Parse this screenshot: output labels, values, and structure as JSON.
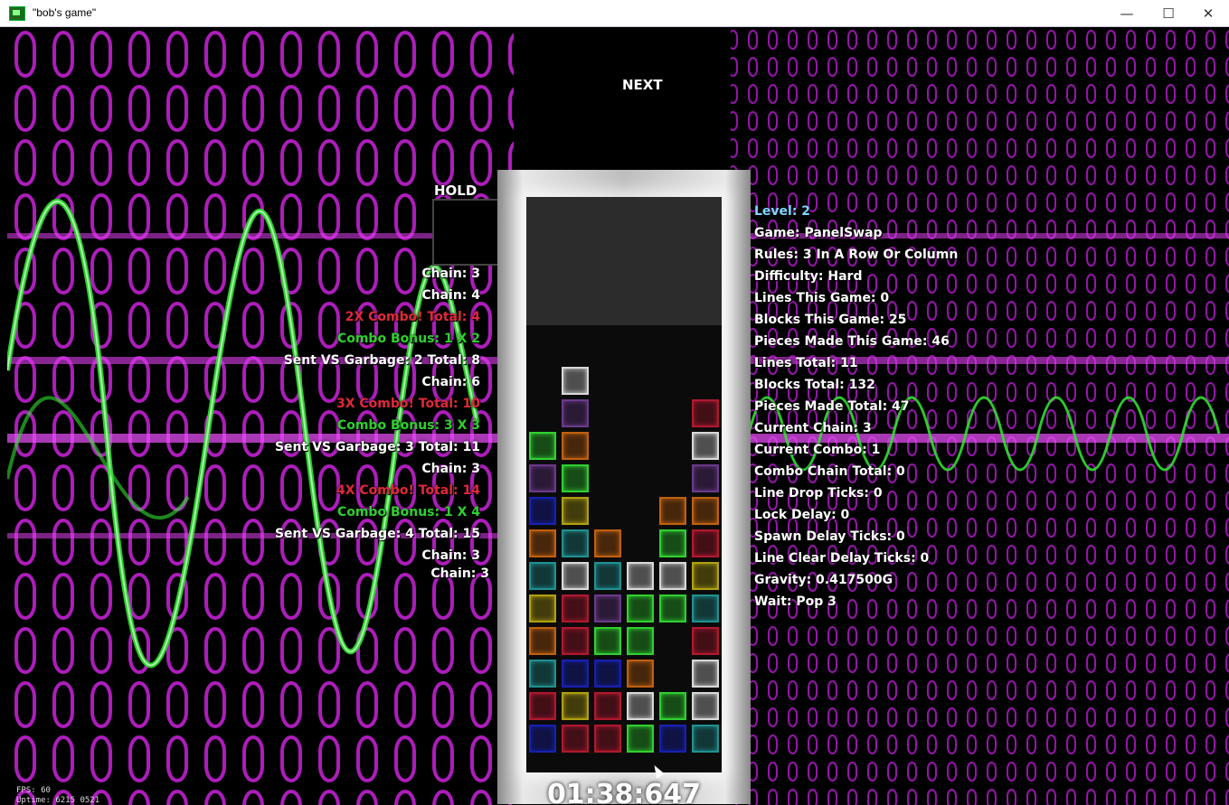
{
  "window": {
    "title": "\"bob's game\"",
    "minimize": "—",
    "maximize": "☐",
    "close": "✕"
  },
  "next_label": "NEXT",
  "hold_label": "HOLD",
  "left_stats": [
    {
      "text": "Chain: 3",
      "color": "white"
    },
    {
      "text": "Chain: 4",
      "color": "white"
    },
    {
      "text": "2X Combo! Total: 4",
      "color": "red"
    },
    {
      "text": "Combo Bonus: 1 X 2",
      "color": "green"
    },
    {
      "text": "Sent VS Garbage: 2 Total: 8",
      "color": "white"
    },
    {
      "text": "Chain: 6",
      "color": "white"
    },
    {
      "text": "3X Combo! Total: 10",
      "color": "red"
    },
    {
      "text": "Combo Bonus: 3 X 3",
      "color": "green"
    },
    {
      "text": "Sent VS Garbage: 3 Total: 11",
      "color": "white"
    },
    {
      "text": "Chain: 3",
      "color": "white"
    },
    {
      "text": "4X Combo! Total: 14",
      "color": "red"
    },
    {
      "text": "Combo Bonus: 1 X 4",
      "color": "green"
    },
    {
      "text": "Sent VS Garbage: 4 Total: 15",
      "color": "white"
    },
    {
      "text": "Chain: 3",
      "color": "white"
    },
    {
      "text": "Chain: 3",
      "color": "white"
    }
  ],
  "right_stats": [
    {
      "text": "Level: 2",
      "color": "blue"
    },
    {
      "text": "Game: PanelSwap",
      "color": "white"
    },
    {
      "text": "Rules: 3 In A Row Or Column",
      "color": "white"
    },
    {
      "text": "Difficulty: Hard",
      "color": "white"
    },
    {
      "text": "Lines This Game: 0",
      "color": "white"
    },
    {
      "text": "Blocks This Game: 25",
      "color": "white"
    },
    {
      "text": "Pieces Made This Game: 46",
      "color": "white"
    },
    {
      "text": "Lines Total: 11",
      "color": "white"
    },
    {
      "text": "Blocks Total: 132",
      "color": "white"
    },
    {
      "text": "Pieces Made Total: 47",
      "color": "white"
    },
    {
      "text": "Current Chain: 3",
      "color": "white"
    },
    {
      "text": "Current Combo: 1",
      "color": "white"
    },
    {
      "text": "Combo Chain Total: 0",
      "color": "white"
    },
    {
      "text": "Line Drop Ticks: 0",
      "color": "white"
    },
    {
      "text": "Lock Delay: 0",
      "color": "white"
    },
    {
      "text": "Spawn Delay Ticks: 0",
      "color": "white"
    },
    {
      "text": "Line Clear Delay Ticks: 0",
      "color": "white"
    },
    {
      "text": "Gravity: 0.417500G",
      "color": "white"
    },
    {
      "text": "Wait: Pop 3",
      "color": "white"
    }
  ],
  "timer": "01:38:647",
  "fps_line1": "FPS: 60",
  "fps_line2": "Uptime: 6215 0521",
  "colors": {
    "magenta": "#c020d0",
    "green": "#30d030",
    "gray": "#d8d8d8",
    "purple": "#6a3a8a",
    "red": "#b01830",
    "orange": "#c06010",
    "yellow": "#b0a010",
    "cyan": "#209090",
    "blue": "#1820b0"
  },
  "board": {
    "cols": 6,
    "rows": 12,
    "cells": [
      [
        "",
        "",
        "",
        "",
        "",
        ""
      ],
      [
        "",
        "gray",
        "",
        "",
        "",
        ""
      ],
      [
        "",
        "purple",
        "",
        "",
        "",
        "red"
      ],
      [
        "green",
        "orange",
        "",
        "",
        "",
        "gray"
      ],
      [
        "purple",
        "green",
        "",
        "",
        "",
        "purple"
      ],
      [
        "blue",
        "yellow",
        "",
        "",
        "orange",
        "orange"
      ],
      [
        "orange",
        "cyan",
        "orange",
        "",
        "green",
        "red"
      ],
      [
        "cyan",
        "gray",
        "cyan",
        "gray",
        "gray",
        "yellow"
      ],
      [
        "yellow",
        "red",
        "purple",
        "green",
        "green",
        "cyan"
      ],
      [
        "orange",
        "red",
        "green",
        "green",
        "",
        "red"
      ],
      [
        "cyan",
        "blue",
        "blue",
        "orange",
        "",
        "gray"
      ],
      [
        "red",
        "yellow",
        "red",
        "gray",
        "green",
        "gray"
      ],
      [
        "blue",
        "red",
        "red",
        "green",
        "blue",
        "cyan"
      ]
    ]
  }
}
